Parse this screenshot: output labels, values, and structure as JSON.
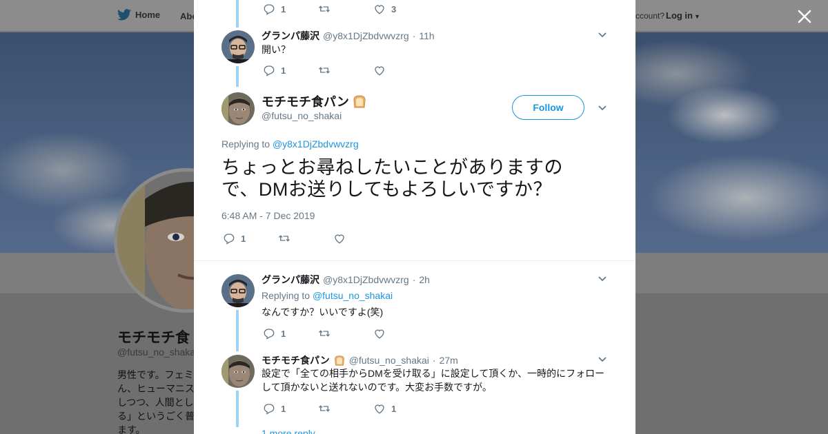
{
  "nav": {
    "home": "Home",
    "about": "Abo",
    "account_prompt": "ccount?",
    "login": "Log in"
  },
  "profile": {
    "name": "モチモチ食",
    "handle": "@futsu_no_shaka",
    "bio": "男性です。フェミ\nん、ヒューマニス\nしつつ、人間とし\nる」というごく普\nます。"
  },
  "thread": {
    "prev_tweet_actions": {
      "replies": "1",
      "retweets": "",
      "likes": "3"
    },
    "tweet1": {
      "name": "グランパ藤沢",
      "handle": "@y8x1DjZbdvwvzrg",
      "time": "11h",
      "text": "開い？",
      "replies": "1",
      "retweets": "",
      "likes": ""
    },
    "main": {
      "name": "モチモチ食パン",
      "handle": "@futsu_no_shakai",
      "follow_label": "Follow",
      "replying_prefix": "Replying to",
      "replying_to": "@y8x1DjZbdvwvzrg",
      "text": "ちょっとお尋ねしたいことがありますので、DMお送りしてもよろしいですか？",
      "timestamp": "6:48 AM - 7 Dec 2019",
      "replies": "1",
      "retweets": "",
      "likes": ""
    },
    "reply1": {
      "name": "グランパ藤沢",
      "handle": "@y8x1DjZbdvwvzrg",
      "time": "2h",
      "replying_prefix": "Replying to",
      "replying_to": "@futsu_no_shakai",
      "text": "なんですか？いいですよ(笑)",
      "replies": "1",
      "retweets": "",
      "likes": ""
    },
    "reply2": {
      "name": "モチモチ食パン",
      "handle": "@futsu_no_shakai",
      "time": "27m",
      "text": "設定で「全ての相手からDMを受け取る」に設定して頂くか、一時的にフォローして頂かないと送れないのです。大変お手数ですが。",
      "replies": "1",
      "retweets": "",
      "likes": "1"
    },
    "more_replies": "1 more reply"
  },
  "colors": {
    "accent": "#1b95e0",
    "thread_line": "#9fd3f6",
    "secondary_text": "#657786"
  },
  "icons": [
    "twitter-bird-icon",
    "reply-icon",
    "retweet-icon",
    "like-icon",
    "chevron-down-icon",
    "close-icon",
    "bread-icon"
  ]
}
